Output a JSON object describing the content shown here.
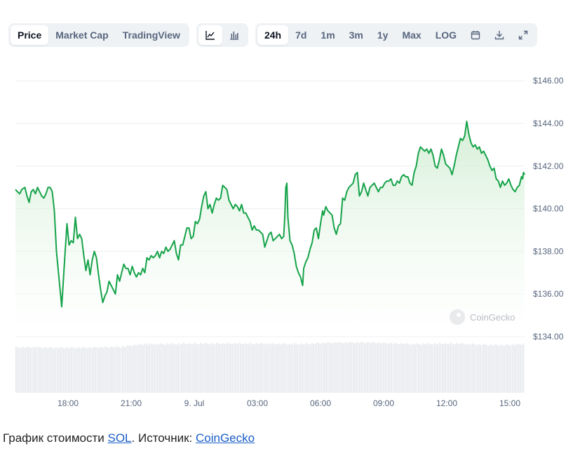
{
  "toolbar": {
    "tabs": [
      "Price",
      "Market Cap",
      "TradingView"
    ],
    "active_tab": "Price",
    "chart_type_icons": [
      "line-chart-icon",
      "bar-chart-icon"
    ],
    "ranges": [
      "24h",
      "7d",
      "1m",
      "3m",
      "1y",
      "Max",
      "LOG"
    ],
    "active_range": "24h",
    "action_icons": [
      "calendar-icon",
      "download-icon",
      "expand-icon"
    ]
  },
  "watermark": "CoinGecko",
  "caption": {
    "prefix": "График стоимости ",
    "coin_link": "SOL",
    "middle": ". Источник: ",
    "source_link": "CoinGecko"
  },
  "colors": {
    "line": "#16a34a",
    "area_top": "#cdeccf",
    "volume": "#e6e8ec",
    "grid": "#eceef1",
    "axis_text": "#58667e",
    "link": "#1a5ec7"
  },
  "chart_data": {
    "type": "line",
    "title": "",
    "xlabel": "",
    "ylabel": "",
    "currency_prefix": "$",
    "ylim": [
      134,
      146.5
    ],
    "yticks": [
      134,
      136,
      138,
      140,
      142,
      144,
      146
    ],
    "ytick_labels": [
      "$134.00",
      "$136.00",
      "$138.00",
      "$140.00",
      "$142.00",
      "$144.00",
      "$146.00"
    ],
    "xticks": [
      {
        "label": "18:00",
        "t": 2.5
      },
      {
        "label": "21:00",
        "t": 5.5
      },
      {
        "label": "9. Jul",
        "t": 8.5
      },
      {
        "label": "03:00",
        "t": 11.5
      },
      {
        "label": "06:00",
        "t": 14.5
      },
      {
        "label": "09:00",
        "t": 17.5
      },
      {
        "label": "12:00",
        "t": 20.5
      },
      {
        "label": "15:00",
        "t": 23.5
      }
    ],
    "x_unit": "hours since chart start",
    "xlim": [
      0,
      24.2
    ],
    "grid": true,
    "series": [
      {
        "values": [
          [
            0.0,
            140.9
          ],
          [
            0.1,
            140.8
          ],
          [
            0.2,
            140.7
          ],
          [
            0.3,
            140.9
          ],
          [
            0.45,
            141.0
          ],
          [
            0.55,
            140.6
          ],
          [
            0.65,
            140.3
          ],
          [
            0.75,
            140.8
          ],
          [
            0.85,
            140.9
          ],
          [
            0.95,
            140.7
          ],
          [
            1.05,
            141.0
          ],
          [
            1.15,
            140.8
          ],
          [
            1.25,
            140.6
          ],
          [
            1.35,
            140.5
          ],
          [
            1.45,
            140.7
          ],
          [
            1.55,
            141.0
          ],
          [
            1.65,
            141.0
          ],
          [
            1.75,
            140.8
          ],
          [
            1.85,
            139.9
          ],
          [
            1.95,
            138.0
          ],
          [
            2.2,
            135.4
          ],
          [
            2.35,
            137.8
          ],
          [
            2.45,
            139.3
          ],
          [
            2.55,
            138.3
          ],
          [
            2.65,
            138.5
          ],
          [
            2.75,
            138.4
          ],
          [
            2.85,
            139.6
          ],
          [
            2.95,
            138.6
          ],
          [
            3.05,
            138.8
          ],
          [
            3.15,
            138.6
          ],
          [
            3.25,
            137.8
          ],
          [
            3.35,
            137.1
          ],
          [
            3.45,
            137.6
          ],
          [
            3.55,
            136.9
          ],
          [
            3.65,
            137.6
          ],
          [
            3.75,
            138.0
          ],
          [
            3.85,
            137.7
          ],
          [
            3.95,
            136.9
          ],
          [
            4.05,
            136.2
          ],
          [
            4.15,
            135.6
          ],
          [
            4.25,
            135.9
          ],
          [
            4.35,
            136.1
          ],
          [
            4.45,
            136.6
          ],
          [
            4.55,
            136.4
          ],
          [
            4.65,
            136.2
          ],
          [
            4.75,
            136.0
          ],
          [
            4.85,
            136.9
          ],
          [
            4.95,
            136.6
          ],
          [
            5.05,
            137.0
          ],
          [
            5.15,
            137.4
          ],
          [
            5.25,
            137.2
          ],
          [
            5.35,
            137.2
          ],
          [
            5.45,
            136.9
          ],
          [
            5.55,
            137.3
          ],
          [
            5.65,
            137.0
          ],
          [
            5.75,
            136.8
          ],
          [
            5.85,
            137.0
          ],
          [
            5.95,
            136.9
          ],
          [
            6.05,
            137.2
          ],
          [
            6.15,
            137.0
          ],
          [
            6.25,
            137.7
          ],
          [
            6.35,
            137.6
          ],
          [
            6.45,
            137.8
          ],
          [
            6.55,
            137.7
          ],
          [
            6.65,
            137.8
          ],
          [
            6.75,
            138.0
          ],
          [
            6.85,
            137.7
          ],
          [
            6.95,
            138.0
          ],
          [
            7.05,
            137.9
          ],
          [
            7.15,
            138.2
          ],
          [
            7.25,
            138.0
          ],
          [
            7.35,
            138.1
          ],
          [
            7.45,
            138.3
          ],
          [
            7.55,
            138.5
          ],
          [
            7.65,
            137.9
          ],
          [
            7.75,
            137.6
          ],
          [
            7.85,
            138.3
          ],
          [
            7.95,
            138.3
          ],
          [
            8.05,
            138.7
          ],
          [
            8.15,
            139.1
          ],
          [
            8.25,
            139.1
          ],
          [
            8.35,
            138.6
          ],
          [
            8.45,
            138.7
          ],
          [
            8.55,
            139.4
          ],
          [
            8.65,
            139.3
          ],
          [
            8.75,
            139.5
          ],
          [
            8.85,
            140.1
          ],
          [
            8.95,
            140.6
          ],
          [
            9.05,
            140.8
          ],
          [
            9.15,
            140.0
          ],
          [
            9.25,
            140.2
          ],
          [
            9.35,
            139.8
          ],
          [
            9.45,
            140.2
          ],
          [
            9.55,
            140.5
          ],
          [
            9.65,
            140.4
          ],
          [
            9.75,
            140.5
          ],
          [
            9.85,
            141.1
          ],
          [
            9.95,
            141.0
          ],
          [
            10.05,
            140.9
          ],
          [
            10.15,
            140.4
          ],
          [
            10.25,
            140.2
          ],
          [
            10.35,
            140.0
          ],
          [
            10.45,
            140.2
          ],
          [
            10.55,
            140.1
          ],
          [
            10.65,
            139.9
          ],
          [
            10.75,
            140.2
          ],
          [
            10.85,
            139.8
          ],
          [
            10.95,
            139.8
          ],
          [
            11.05,
            139.6
          ],
          [
            11.15,
            139.4
          ],
          [
            11.25,
            139.0
          ],
          [
            11.35,
            139.2
          ],
          [
            11.45,
            139.0
          ],
          [
            11.55,
            139.0
          ],
          [
            11.65,
            138.9
          ],
          [
            11.75,
            138.8
          ],
          [
            11.85,
            138.2
          ],
          [
            11.95,
            138.5
          ],
          [
            12.05,
            138.8
          ],
          [
            12.15,
            138.9
          ],
          [
            12.25,
            138.5
          ],
          [
            12.35,
            138.6
          ],
          [
            12.45,
            138.7
          ],
          [
            12.55,
            138.8
          ],
          [
            12.65,
            138.6
          ],
          [
            12.75,
            138.7
          ],
          [
            12.8,
            139.6
          ],
          [
            12.85,
            141.0
          ],
          [
            12.9,
            141.2
          ],
          [
            12.95,
            139.6
          ],
          [
            13.05,
            138.5
          ],
          [
            13.15,
            138.3
          ],
          [
            13.25,
            137.9
          ],
          [
            13.35,
            137.3
          ],
          [
            13.45,
            137.0
          ],
          [
            13.55,
            136.8
          ],
          [
            13.65,
            136.4
          ],
          [
            13.7,
            137.2
          ],
          [
            13.8,
            137.5
          ],
          [
            13.9,
            137.7
          ],
          [
            14.0,
            138.1
          ],
          [
            14.1,
            138.4
          ],
          [
            14.2,
            139.0
          ],
          [
            14.3,
            139.1
          ],
          [
            14.4,
            138.6
          ],
          [
            14.5,
            139.3
          ],
          [
            14.6,
            139.9
          ],
          [
            14.65,
            139.7
          ],
          [
            14.75,
            140.1
          ],
          [
            14.85,
            139.9
          ],
          [
            14.95,
            139.8
          ],
          [
            15.05,
            139.7
          ],
          [
            15.15,
            139.1
          ],
          [
            15.25,
            138.8
          ],
          [
            15.35,
            139.2
          ],
          [
            15.45,
            139.3
          ],
          [
            15.55,
            140.5
          ],
          [
            15.65,
            140.4
          ],
          [
            15.75,
            140.8
          ],
          [
            15.85,
            141.0
          ],
          [
            15.95,
            141.1
          ],
          [
            16.05,
            141.2
          ],
          [
            16.15,
            141.6
          ],
          [
            16.25,
            141.7
          ],
          [
            16.35,
            140.6
          ],
          [
            16.45,
            140.8
          ],
          [
            16.55,
            141.2
          ],
          [
            16.65,
            140.9
          ],
          [
            16.75,
            140.6
          ],
          [
            16.85,
            141.0
          ],
          [
            16.95,
            141.1
          ],
          [
            17.05,
            141.2
          ],
          [
            17.15,
            141.0
          ],
          [
            17.25,
            140.8
          ],
          [
            17.35,
            141.0
          ],
          [
            17.45,
            141.0
          ],
          [
            17.55,
            141.2
          ],
          [
            17.65,
            141.3
          ],
          [
            17.75,
            141.3
          ],
          [
            17.85,
            141.4
          ],
          [
            17.95,
            141.1
          ],
          [
            18.05,
            141.1
          ],
          [
            18.15,
            141.3
          ],
          [
            18.25,
            141.2
          ],
          [
            18.35,
            141.5
          ],
          [
            18.45,
            141.6
          ],
          [
            18.55,
            141.5
          ],
          [
            18.65,
            141.5
          ],
          [
            18.75,
            141.2
          ],
          [
            18.85,
            141.1
          ],
          [
            18.95,
            141.7
          ],
          [
            19.05,
            142.0
          ],
          [
            19.15,
            142.6
          ],
          [
            19.25,
            142.9
          ],
          [
            19.35,
            142.8
          ],
          [
            19.45,
            142.7
          ],
          [
            19.55,
            142.8
          ],
          [
            19.65,
            142.6
          ],
          [
            19.75,
            142.8
          ],
          [
            19.85,
            142.5
          ],
          [
            19.95,
            142.0
          ],
          [
            20.05,
            141.9
          ],
          [
            20.15,
            142.3
          ],
          [
            20.25,
            142.8
          ],
          [
            20.35,
            142.5
          ],
          [
            20.45,
            142.1
          ],
          [
            20.55,
            142.0
          ],
          [
            20.65,
            141.9
          ],
          [
            20.75,
            141.6
          ],
          [
            20.85,
            142.0
          ],
          [
            20.95,
            142.5
          ],
          [
            21.05,
            142.9
          ],
          [
            21.15,
            143.3
          ],
          [
            21.25,
            143.2
          ],
          [
            21.35,
            143.4
          ],
          [
            21.45,
            144.1
          ],
          [
            21.55,
            143.5
          ],
          [
            21.65,
            143.1
          ],
          [
            21.75,
            142.9
          ],
          [
            21.85,
            143.0
          ],
          [
            21.95,
            142.8
          ],
          [
            22.05,
            142.9
          ],
          [
            22.15,
            142.6
          ],
          [
            22.25,
            142.7
          ],
          [
            22.35,
            142.5
          ],
          [
            22.45,
            142.3
          ],
          [
            22.55,
            142.0
          ],
          [
            22.65,
            141.8
          ],
          [
            22.75,
            141.9
          ],
          [
            22.85,
            141.4
          ],
          [
            22.95,
            141.3
          ],
          [
            23.05,
            141.0
          ],
          [
            23.15,
            141.3
          ],
          [
            23.25,
            141.1
          ],
          [
            23.35,
            141.2
          ],
          [
            23.45,
            141.4
          ],
          [
            23.55,
            141.1
          ],
          [
            23.65,
            140.9
          ],
          [
            23.75,
            140.8
          ],
          [
            23.85,
            141.0
          ],
          [
            23.95,
            141.1
          ],
          [
            24.0,
            141.3
          ],
          [
            24.05,
            141.5
          ],
          [
            24.1,
            141.4
          ],
          [
            24.15,
            141.7
          ],
          [
            24.2,
            141.6
          ]
        ]
      }
    ],
    "volume": {
      "note": "relative volume bars, roughly uniform",
      "levels": [
        0.88,
        0.88,
        0.87,
        0.87,
        0.88,
        0.89,
        0.94,
        0.94,
        0.95,
        0.95,
        0.95,
        0.95,
        0.95,
        0.94,
        0.95,
        0.97,
        0.97,
        0.97,
        0.95,
        0.94,
        0.95,
        0.95,
        0.93,
        0.92,
        0.94
      ]
    }
  }
}
